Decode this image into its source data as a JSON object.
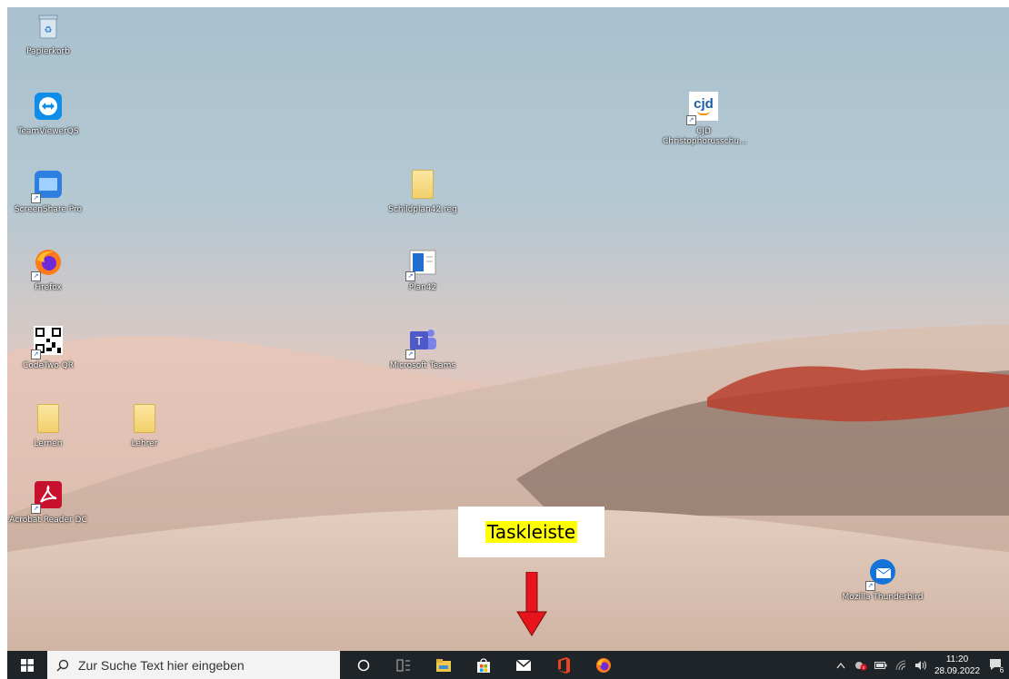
{
  "desktop": {
    "icons": [
      {
        "id": "recycle",
        "label": "Papierkorb"
      },
      {
        "id": "teamviewer",
        "label": "TeamViewerQS"
      },
      {
        "id": "screenshare",
        "label": "ScreenShare Pro"
      },
      {
        "id": "firefox",
        "label": "Firefox"
      },
      {
        "id": "codetwo",
        "label": "CodeTwo QR"
      },
      {
        "id": "lernen",
        "label": "Lernen"
      },
      {
        "id": "lehrer",
        "label": "Lehrer"
      },
      {
        "id": "acrobat",
        "label": "Acrobat Reader DC"
      },
      {
        "id": "schildplan",
        "label": "Schildplan42.reg"
      },
      {
        "id": "plan42",
        "label": "Plan42"
      },
      {
        "id": "teams",
        "label": "Microsoft Teams"
      },
      {
        "id": "cjd",
        "label_line1": "CJD",
        "label_line2": "Christophorusschu...",
        "logo_text": "cjd"
      },
      {
        "id": "thunderbird",
        "label": "Mozilla Thunderbird"
      }
    ]
  },
  "annotation": {
    "text": "Taskleiste"
  },
  "taskbar": {
    "search_placeholder": "Zur Suche Text hier eingeben",
    "clock_time": "11:20",
    "clock_date": "28.09.2022",
    "notification_count": "6",
    "colors": {
      "bar": "#1f2428",
      "search_bg": "#f3f3f3",
      "office": "#e8441d",
      "explorer": "#f2c94c",
      "store": "#f2c94c"
    }
  }
}
